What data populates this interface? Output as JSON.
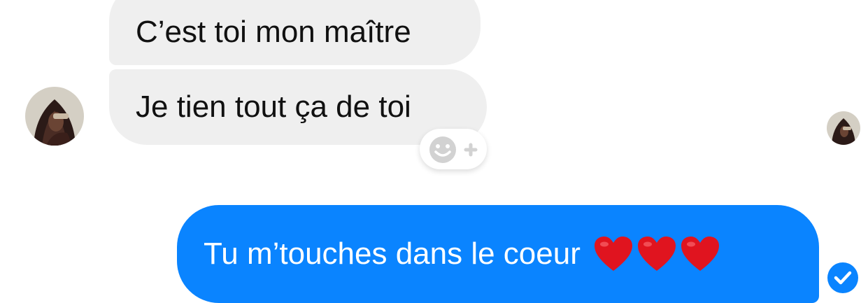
{
  "colors": {
    "incoming_bubble": "#efefef",
    "outgoing_bubble": "#0a84ff",
    "incoming_text": "#111111",
    "outgoing_text": "#ffffff",
    "heart": "#e0141f"
  },
  "messages": [
    {
      "direction": "incoming",
      "text": "C’est toi mon maître"
    },
    {
      "direction": "incoming",
      "text": "Je tien tout ça de toi"
    },
    {
      "direction": "outgoing",
      "text": "Tu m’touches dans le coeur",
      "emoji": [
        "heart-icon",
        "heart-icon",
        "heart-icon"
      ]
    }
  ],
  "icons": {
    "reaction_button": "smiley-plus-icon",
    "delivered": "check-circle-icon",
    "contact_avatar": "avatar-photo",
    "seen_avatar": "avatar-photo"
  }
}
